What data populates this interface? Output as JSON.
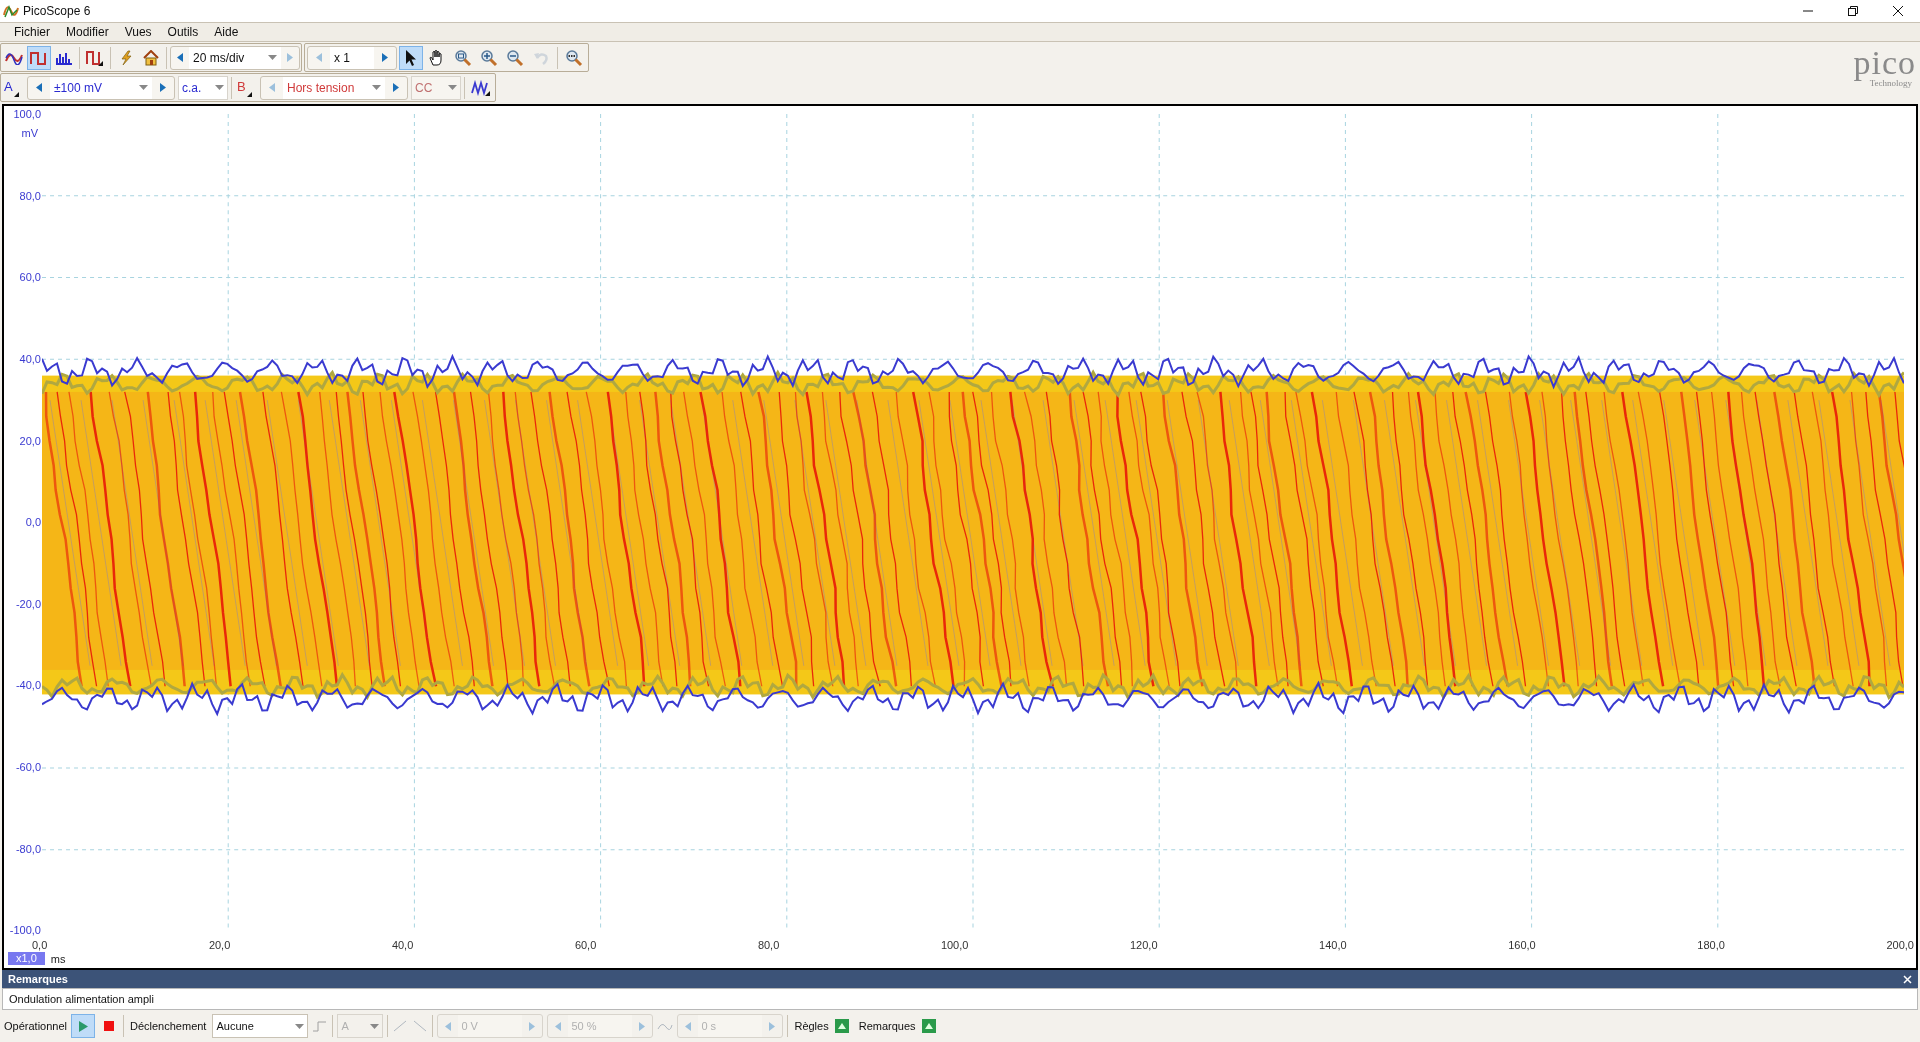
{
  "window": {
    "title": "PicoScope 6"
  },
  "menu": [
    "Fichier",
    "Modifier",
    "Vues",
    "Outils",
    "Aide"
  ],
  "modes": [
    {
      "kind": "persistence",
      "selected": false
    },
    {
      "kind": "scope",
      "selected": true
    },
    {
      "kind": "spectrum",
      "selected": false
    }
  ],
  "timebase": "20 ms/div",
  "zoom": "x 1",
  "tools": [
    {
      "kind": "pointer",
      "selected": true,
      "disabled": false
    },
    {
      "kind": "hand",
      "selected": false,
      "disabled": false
    },
    {
      "kind": "zoom-area",
      "selected": false,
      "disabled": false
    },
    {
      "kind": "zoom-in",
      "selected": false,
      "disabled": false
    },
    {
      "kind": "zoom-out",
      "selected": false,
      "disabled": false
    },
    {
      "kind": "undo",
      "selected": false,
      "disabled": true
    }
  ],
  "channels": [
    {
      "letter": "A",
      "range": "±100 mV",
      "coupling": "c.a.",
      "color": "#2a2ad0",
      "coupling_disabled": false
    },
    {
      "letter": "B",
      "range": "Hors tension",
      "coupling": "CC",
      "color": "#d03a3a",
      "coupling_disabled": true
    }
  ],
  "logo": {
    "name": "pico",
    "tagline": "Technology"
  },
  "plot": {
    "y_labels": [
      "100,0",
      "80,0",
      "60,0",
      "40,0",
      "20,0",
      "0,0",
      "-20,0",
      "-40,0",
      "-60,0",
      "-80,0",
      "-100,0"
    ],
    "y_unit": "mV",
    "x_labels": [
      "0,0",
      "20,0",
      "40,0",
      "60,0",
      "80,0",
      "100,0",
      "120,0",
      "140,0",
      "160,0",
      "180,0",
      "200,0"
    ],
    "x_unit": "ms",
    "x_zoom": "x1,0"
  },
  "notes": {
    "title": "Remarques",
    "text": "Ondulation alimentation ampli"
  },
  "status": {
    "run_label": "Opérationnel",
    "running": true,
    "trigger_label": "Déclenchement",
    "trigger_mode": "Aucune",
    "trigger_source": "A",
    "threshold": "0 V",
    "pretrigger": "50 %",
    "delay": "0 s",
    "rulers": "Règles",
    "notes_label": "Remarques"
  }
}
